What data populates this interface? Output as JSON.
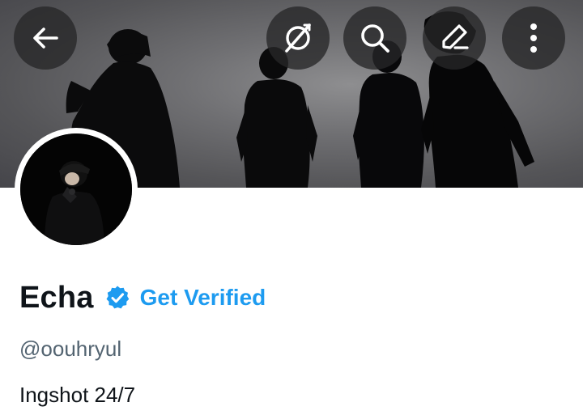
{
  "profile": {
    "display_name": "Echa",
    "verified_badge": "verified-badge-icon",
    "get_verified_label": "Get Verified",
    "handle": "@oouhryul",
    "bio": "Ingshot 24/7"
  },
  "top_bar": {
    "icons": [
      "back-arrow-icon",
      "grok-icon",
      "search-icon",
      "edit-icon",
      "more-vertical-icon"
    ]
  },
  "colors": {
    "accent": "#1d9bf0",
    "text_primary": "#0f1419",
    "text_secondary": "#536471",
    "button_overlay": "#262628"
  }
}
